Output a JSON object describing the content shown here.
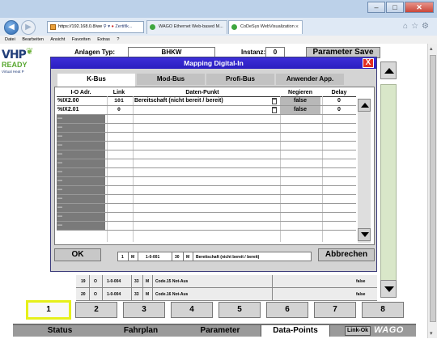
{
  "browser": {
    "address_url": "https://192.168.0.8/we",
    "address_suffix": "Zertifik...",
    "tabs": [
      {
        "label": "WAGO Ethernet Web-based M..."
      },
      {
        "label": "CoDeSys WebVisualization"
      }
    ],
    "tab_close": "×",
    "menu": [
      "Datei",
      "Bearbeiten",
      "Ansicht",
      "Favoriten",
      "Extras",
      "?"
    ]
  },
  "header": {
    "logo_vhp": "VHP",
    "logo_ready": "READY",
    "logo_sub": "Virtual Heat P",
    "anlagen_label": "Anlagen Typ:",
    "anlagen_value": "BHKW",
    "instanz_label": "Instanz:",
    "instanz_value": "0",
    "param_save": "Parameter Save"
  },
  "dialog": {
    "title": "Mapping Digital-In",
    "close": "X",
    "tabs": [
      {
        "label": "K-Bus",
        "active": true
      },
      {
        "label": "Mod-Bus",
        "active": false
      },
      {
        "label": "Profi-Bus",
        "active": false
      },
      {
        "label": "Anwender App.",
        "active": false
      }
    ],
    "columns": {
      "io": "I-O Adr.",
      "link": "Link",
      "dp": "Daten-Punkt",
      "neg": "Negieren",
      "delay": "Delay"
    },
    "rows": [
      {
        "io": "%IX2.00",
        "link": "101",
        "dp": "Bereitschaft (nicht bereit / bereit)",
        "neg": "false",
        "delay": "0"
      },
      {
        "io": "%IX2.01",
        "link": "0",
        "dp": "",
        "neg": "false",
        "delay": "0"
      },
      {
        "io": "---"
      },
      {
        "io": "---"
      },
      {
        "io": "---"
      },
      {
        "io": "---"
      },
      {
        "io": "---"
      },
      {
        "io": "---"
      },
      {
        "io": "---"
      },
      {
        "io": "---"
      },
      {
        "io": "---"
      },
      {
        "io": "---"
      },
      {
        "io": "---"
      },
      {
        "io": "---"
      },
      {
        "io": "---"
      }
    ],
    "ok": "OK",
    "cancel": "Abbrechen",
    "footer": {
      "c1": "1",
      "c2": "M",
      "c3": "1-0-001",
      "c4": "30",
      "c5": "M",
      "c6": "Bereitschaft (nicht bereit / bereit)"
    }
  },
  "background_rows": [
    {
      "n": "19",
      "t": "O",
      "code": "1-0-004",
      "num": "33",
      "m": "M",
      "text": "Code.15 Not-Aus",
      "val": "false"
    },
    {
      "n": "20",
      "t": "O",
      "code": "1-0-004",
      "num": "33",
      "m": "M",
      "text": "Code.16 Not-Aus",
      "val": "false"
    }
  ],
  "number_buttons": [
    "1",
    "2",
    "3",
    "4",
    "5",
    "6",
    "7",
    "8"
  ],
  "active_number": "1",
  "status_tabs": [
    {
      "label": "Status",
      "active": false
    },
    {
      "label": "Fahrplan",
      "active": false
    },
    {
      "label": "Parameter",
      "active": false
    },
    {
      "label": "Data-Points",
      "active": true
    }
  ],
  "link_status": "Link-Ok",
  "brand": "WAGO",
  "colors": {
    "dialog_title_bg": "#2a1ec0",
    "close_red": "#e22f22",
    "active_highlight": "#e6f01a",
    "sidebar_green": "#d9e7c9"
  }
}
